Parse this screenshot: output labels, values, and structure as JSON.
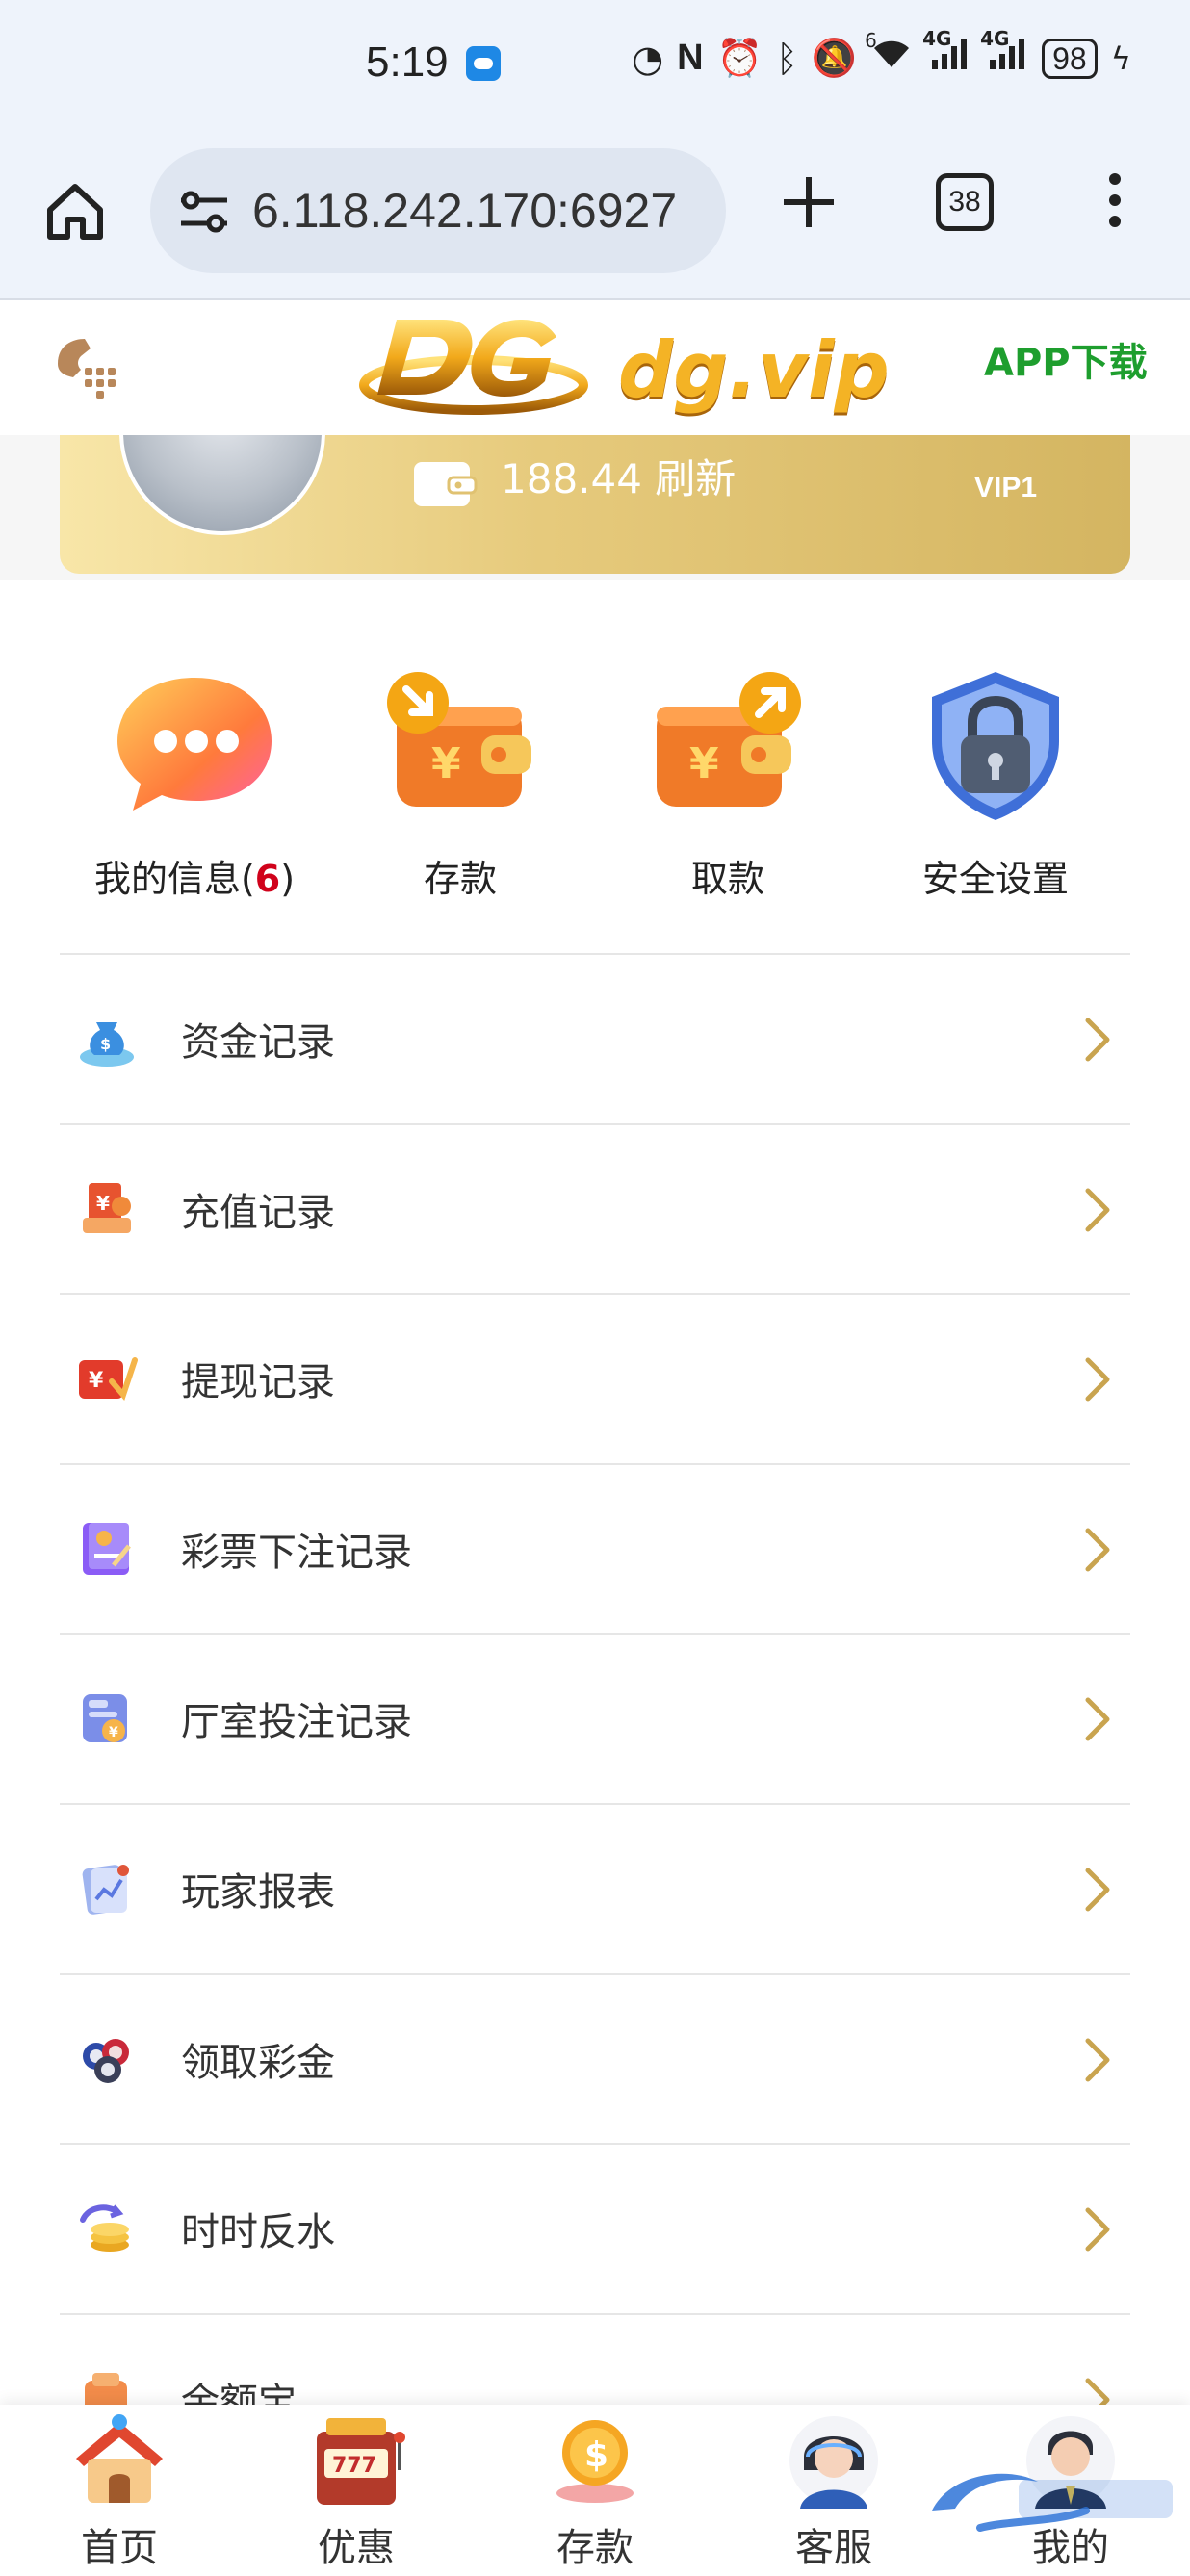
{
  "status_bar": {
    "time": "5:19",
    "signal_labels": [
      "6",
      "4G",
      "4G"
    ],
    "battery": "98"
  },
  "browser": {
    "url": "6.118.242.170:6927",
    "tab_count": "38"
  },
  "site_header": {
    "logo_text": "dg.vip",
    "app_download": "APP下载"
  },
  "user_card": {
    "balance_text": "188.44 刷新",
    "vip_level": "VIP1"
  },
  "quick_actions": [
    {
      "label": "我的信息(",
      "count": "6",
      "suffix": ")",
      "icon": "chat-bubble-icon"
    },
    {
      "label": "存款",
      "icon": "deposit-wallet-icon"
    },
    {
      "label": "取款",
      "icon": "withdraw-wallet-icon"
    },
    {
      "label": "安全设置",
      "icon": "security-lock-icon"
    }
  ],
  "menu_items": [
    {
      "label": "资金记录",
      "icon": "money-bag-icon"
    },
    {
      "label": "充值记录",
      "icon": "recharge-icon"
    },
    {
      "label": "提现记录",
      "icon": "withdraw-record-icon"
    },
    {
      "label": "彩票下注记录",
      "icon": "lottery-book-icon"
    },
    {
      "label": "厅室投注记录",
      "icon": "bet-card-icon"
    },
    {
      "label": "玩家报表",
      "icon": "report-icon"
    },
    {
      "label": "领取彩金",
      "icon": "bonus-chips-icon"
    },
    {
      "label": "时时反水",
      "icon": "rebate-coins-icon"
    },
    {
      "label": "余额宝",
      "icon": "yuebao-icon"
    }
  ],
  "bottom_nav": [
    {
      "label": "首页",
      "icon": "home-house-icon"
    },
    {
      "label": "优惠",
      "icon": "slot-machine-icon"
    },
    {
      "label": "存款",
      "icon": "coin-icon"
    },
    {
      "label": "客服",
      "icon": "support-agent-icon"
    },
    {
      "label": "我的",
      "icon": "profile-avatar-icon"
    }
  ],
  "colors": {
    "accent_gold": "#c9a44f",
    "app_download_green": "#1e9e2e",
    "count_red": "#d0021b"
  }
}
